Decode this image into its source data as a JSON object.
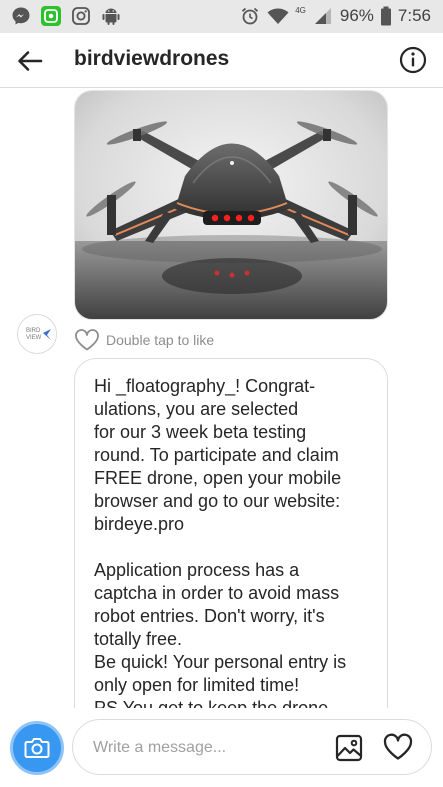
{
  "status_bar": {
    "battery": "96%",
    "time": "7:56",
    "network": "4G",
    "left_icons": [
      "messenger-icon",
      "whatsapp-icon",
      "instagram-icon",
      "android-icon"
    ],
    "right_icons": [
      "alarm-icon",
      "wifi-icon",
      "signal-icon",
      "battery-icon"
    ]
  },
  "header": {
    "title": "birdviewdrones",
    "back_icon": "arrow-left-icon",
    "info_icon": "info-icon"
  },
  "thread": {
    "image": {
      "description": "photo of a quadcopter drone",
      "image_icon": "drone-photo"
    },
    "avatar": {
      "line1": "BIRD",
      "line2": "VIEW"
    },
    "like_hint": "Double tap to like",
    "message": {
      "lines": [
        "Hi _floatography_! Congrat-",
        "ulations, you are selected",
        "for our 3 week beta testing",
        "round. To participate and claim",
        "FREE drone, open your mobile",
        "browser and go to our website:",
        "birdeye.pro",
        "",
        "Application process has a",
        "captcha in order to avoid mass",
        "robot entries. Don't worry, it's",
        "totally free.",
        "Be quick! Your personal entry is",
        "only open for limited time!",
        "PS You get to keep the drone."
      ]
    }
  },
  "composer": {
    "placeholder": "Write a message...",
    "camera_icon": "camera-icon",
    "gallery_icon": "image-icon",
    "heart_icon": "heart-icon"
  },
  "colors": {
    "accent_blue": "#3897f0",
    "border_grey": "#dbdbdb",
    "status_bar_bg": "#e8e8e8",
    "text": "#262626",
    "muted": "#8e8e8e"
  }
}
